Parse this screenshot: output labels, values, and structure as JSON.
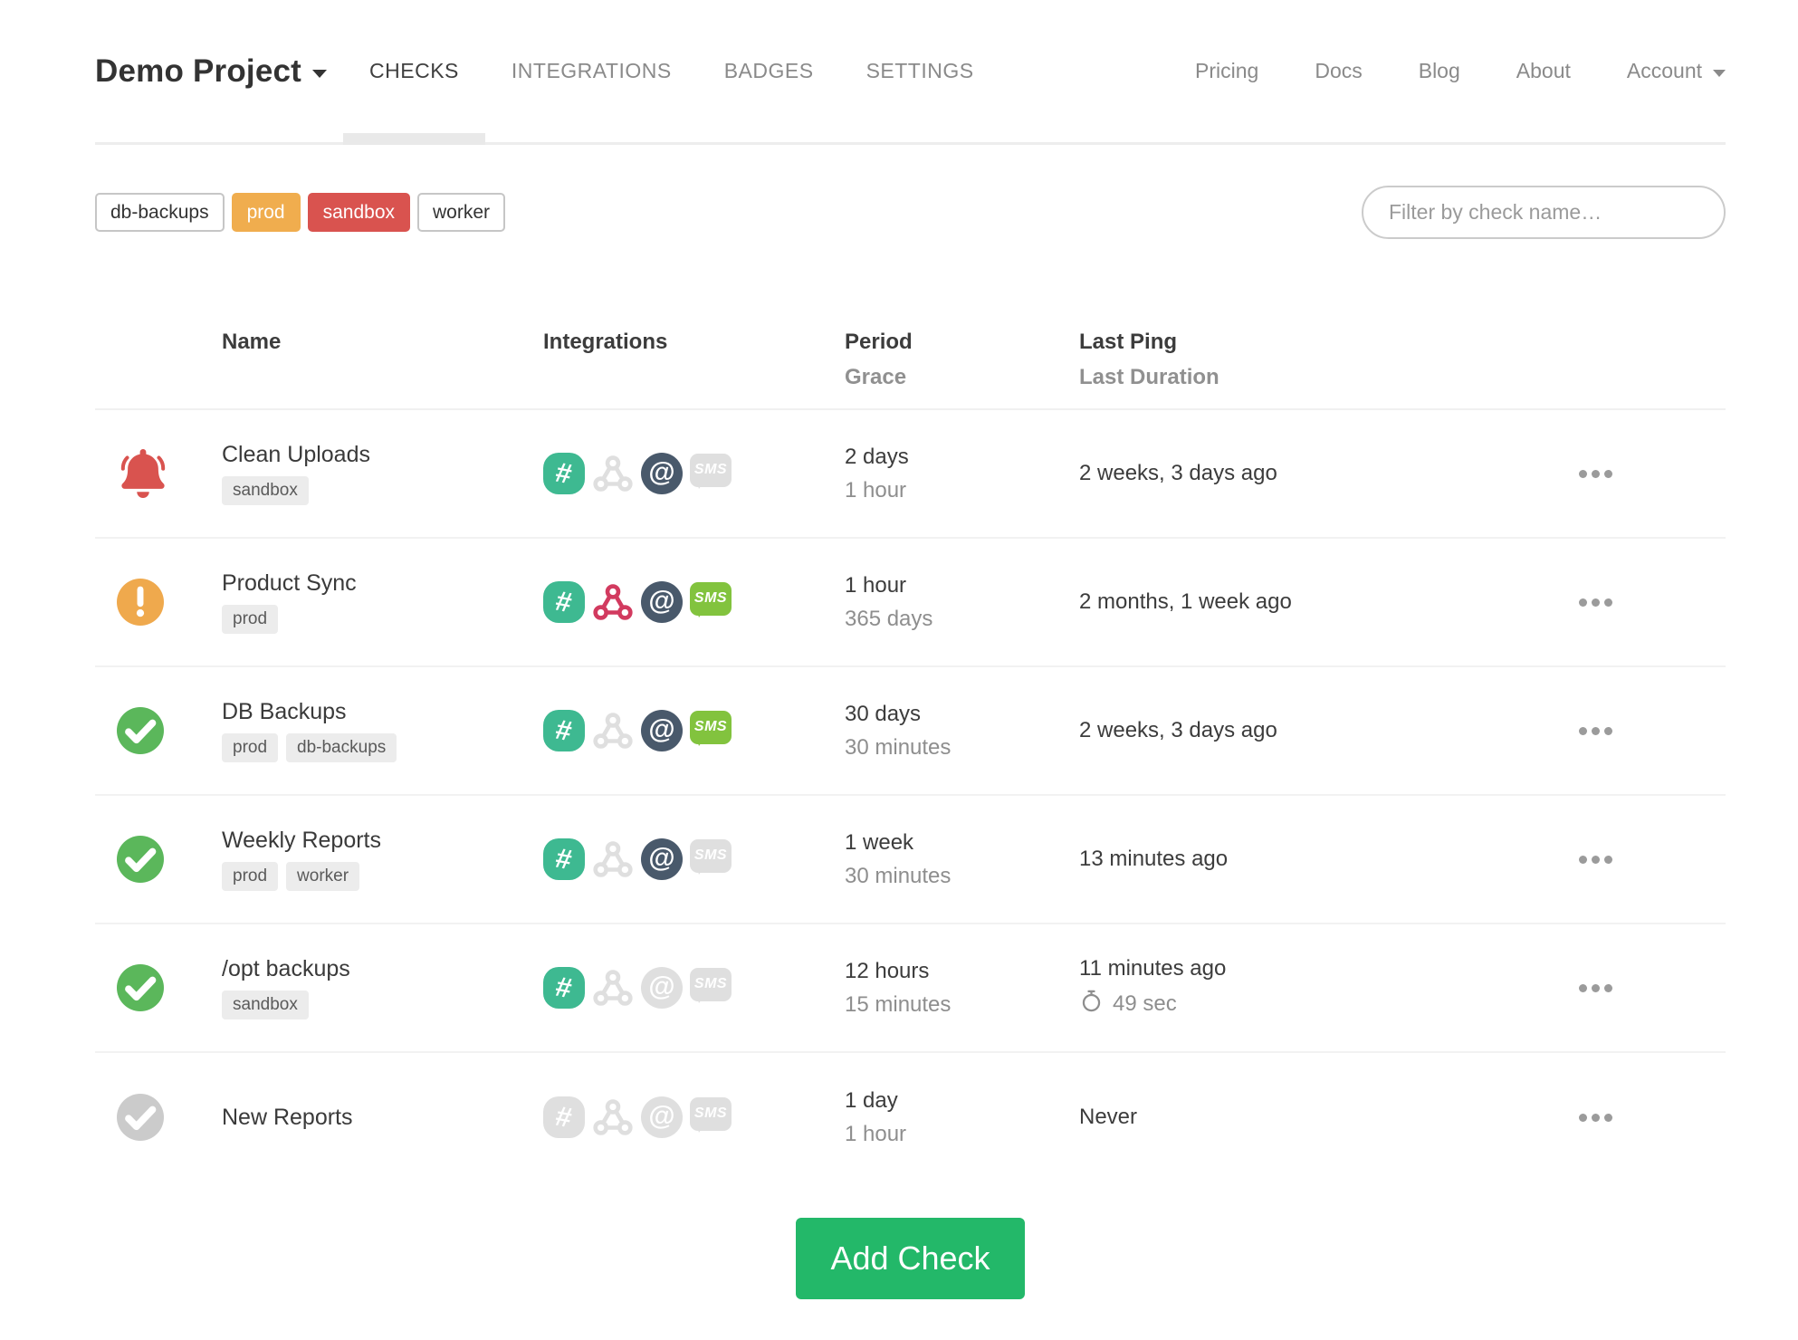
{
  "nav": {
    "project_name": "Demo Project",
    "tabs": [
      {
        "label": "CHECKS",
        "active": true
      },
      {
        "label": "INTEGRATIONS",
        "active": false
      },
      {
        "label": "BADGES",
        "active": false
      },
      {
        "label": "SETTINGS",
        "active": false
      }
    ],
    "links": [
      {
        "label": "Pricing"
      },
      {
        "label": "Docs"
      },
      {
        "label": "Blog"
      },
      {
        "label": "About"
      }
    ],
    "account_label": "Account"
  },
  "filter_bar": {
    "tags": [
      {
        "label": "db-backups",
        "style": "outline"
      },
      {
        "label": "prod",
        "style": "orange"
      },
      {
        "label": "sandbox",
        "style": "red"
      },
      {
        "label": "worker",
        "style": "outline"
      }
    ],
    "search_placeholder": "Filter by check name…"
  },
  "table": {
    "headers": {
      "name": "Name",
      "integrations": "Integrations",
      "period": "Period",
      "grace": "Grace",
      "last_ping": "Last Ping",
      "last_duration": "Last Duration"
    },
    "rows": [
      {
        "status": "alert",
        "name": "Clean Uploads",
        "tags": [
          "sandbox"
        ],
        "integrations": {
          "slack": true,
          "webhook": false,
          "email": true,
          "sms": false
        },
        "period": "2 days",
        "grace": "1 hour",
        "last_ping": "2 weeks, 3 days ago",
        "last_duration": ""
      },
      {
        "status": "warning",
        "name": "Product Sync",
        "tags": [
          "prod"
        ],
        "integrations": {
          "slack": true,
          "webhook": true,
          "email": true,
          "sms": true
        },
        "period": "1 hour",
        "grace": "365 days",
        "last_ping": "2 months, 1 week ago",
        "last_duration": ""
      },
      {
        "status": "ok",
        "name": "DB Backups",
        "tags": [
          "prod",
          "db-backups"
        ],
        "integrations": {
          "slack": true,
          "webhook": false,
          "email": true,
          "sms": true
        },
        "period": "30 days",
        "grace": "30 minutes",
        "last_ping": "2 weeks, 3 days ago",
        "last_duration": ""
      },
      {
        "status": "ok",
        "name": "Weekly Reports",
        "tags": [
          "prod",
          "worker"
        ],
        "integrations": {
          "slack": true,
          "webhook": false,
          "email": true,
          "sms": false
        },
        "period": "1 week",
        "grace": "30 minutes",
        "last_ping": "13 minutes ago",
        "last_duration": ""
      },
      {
        "status": "ok",
        "name": "/opt backups",
        "tags": [
          "sandbox"
        ],
        "integrations": {
          "slack": true,
          "webhook": false,
          "email": false,
          "sms": false
        },
        "period": "12 hours",
        "grace": "15 minutes",
        "last_ping": "11 minutes ago",
        "last_duration": "49 sec"
      },
      {
        "status": "new",
        "name": "New Reports",
        "tags": [],
        "integrations": {
          "slack": false,
          "webhook": false,
          "email": false,
          "sms": false
        },
        "period": "1 day",
        "grace": "1 hour",
        "last_ping": "Never",
        "last_duration": ""
      }
    ]
  },
  "icons": {
    "slack_glyph": "#",
    "email_glyph": "@",
    "sms_glyph": "SMS"
  },
  "add_check_label": "Add Check",
  "colors": {
    "accent_green": "#23b869",
    "tag_orange": "#f0ad4e",
    "tag_red": "#d9534f",
    "status_ok": "#5bb75b",
    "status_warning": "#efa94d",
    "status_alert": "#d9534f",
    "status_new": "#cbcbcb",
    "slack": "#3eb991",
    "webhook": "#d23a5f",
    "email": "#49596b",
    "sms": "#82c33e",
    "divider": "#ededed"
  }
}
